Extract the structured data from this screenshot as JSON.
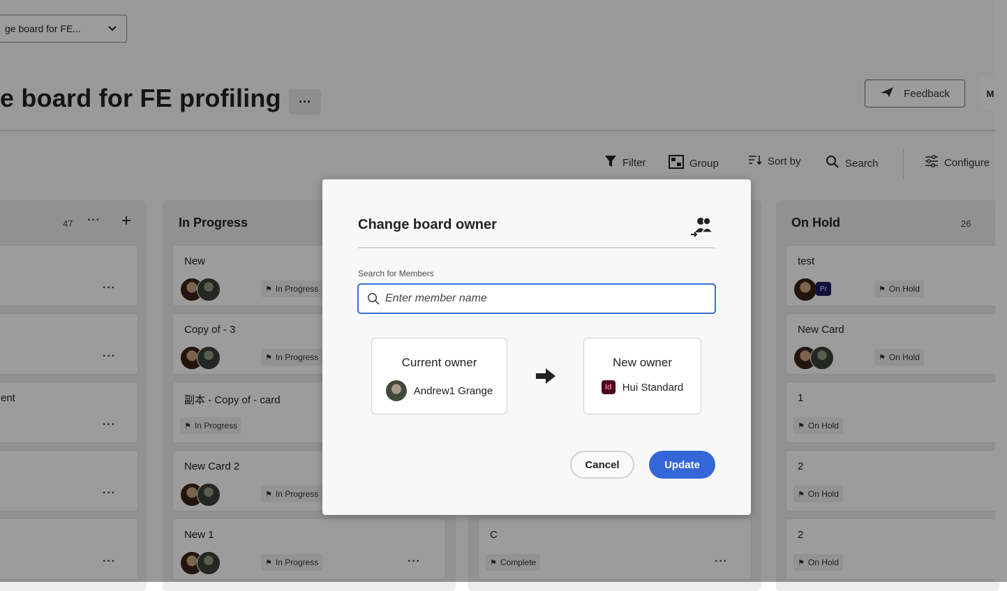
{
  "header": {
    "board_select_value": "ge board for FE...",
    "board_title": "e board for FE profiling 1",
    "title_more": "···",
    "feedback_label": "Feedback",
    "extra_button_label": "M"
  },
  "toolbar": {
    "filter": "Filter",
    "group": "Group",
    "sort_by": "Sort by",
    "search": "Search",
    "configure": "Configure"
  },
  "columns": [
    {
      "title": "",
      "count": "47",
      "more": "···",
      "add": "+",
      "cards": [
        {
          "title": ""
        },
        {
          "title": ""
        },
        {
          "title": "ent"
        },
        {
          "title": ""
        },
        {
          "title": ""
        }
      ]
    },
    {
      "title": "In Progress",
      "cards": [
        {
          "title": "New",
          "status": "In Progress"
        },
        {
          "title": "Copy of - 3",
          "status": "In Progress"
        },
        {
          "title": "副本 - Copy of - card",
          "status": "In Progress"
        },
        {
          "title": "New Card 2",
          "status": "In Progress"
        },
        {
          "title": "New 1",
          "status": "In Progress"
        }
      ]
    },
    {
      "title": "",
      "cards": [
        {
          "title": "C",
          "status": "Complete"
        }
      ]
    },
    {
      "title": "On Hold",
      "count": "26",
      "cards": [
        {
          "title": "test",
          "status": "On Hold",
          "badge": "Pr"
        },
        {
          "title": "New Card",
          "status": "On Hold"
        },
        {
          "title": "1",
          "status": "On Hold"
        },
        {
          "title": "2",
          "status": "On Hold"
        },
        {
          "title": "2",
          "status": "On Hold"
        }
      ]
    }
  ],
  "dialog": {
    "title": "Change board owner",
    "search_label": "Search for Members",
    "search_placeholder": "Enter member name",
    "search_value": "",
    "current_owner_label": "Current owner",
    "current_owner_name": "Andrew1 Grange",
    "new_owner_label": "New owner",
    "new_owner_name": "Hui Standard",
    "new_owner_badge": "Id",
    "cancel_label": "Cancel",
    "update_label": "Update"
  },
  "icons": {
    "dialog_header": "people-swap-icon",
    "arrow": "arrow-right-icon",
    "search": "search-icon"
  },
  "colors": {
    "primary_button": "#3466d8",
    "focus_border": "#3a6fd8",
    "overlay": "rgba(0,0,0,0.39)"
  }
}
